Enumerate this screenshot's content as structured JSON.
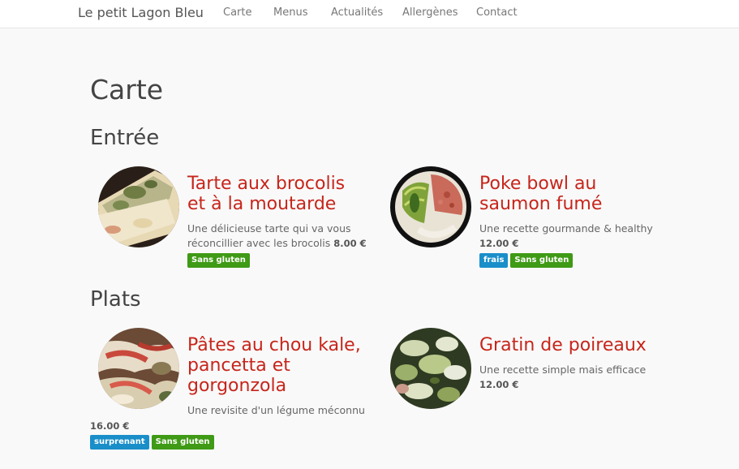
{
  "nav": {
    "brand": "Le petit Lagon Bleu",
    "links": [
      "Carte",
      "Menus",
      "Actualités",
      "Allergènes",
      "Contact"
    ]
  },
  "page_title": "Carte",
  "sections": [
    {
      "heading": "Entrée",
      "dishes": [
        {
          "title_lines": [
            "Tarte aux brocolis",
            "et à la moutarde"
          ],
          "description_lines": [
            "Une délicieuse tarte qui va vous",
            "réconcillier avec les brocolis"
          ],
          "price": "8.00 €",
          "tags": [
            "Sans gluten"
          ],
          "image_icon": "broccoli-tart-photo"
        },
        {
          "title_lines": [
            "Poke bowl au",
            "saumon fumé"
          ],
          "description_lines": [
            "Une recette gourmande & healthy"
          ],
          "price": "12.00 €",
          "tags": [
            "frais",
            "Sans gluten"
          ],
          "image_icon": "poke-bowl-photo"
        }
      ]
    },
    {
      "heading": "Plats",
      "dishes": [
        {
          "title_lines": [
            "Pâtes au chou kale,",
            "pancetta et",
            "gorgonzola"
          ],
          "description_lines": [
            "Une revisite d'un légume méconnu"
          ],
          "price": "16.00 €",
          "tags": [
            "surprenant",
            "Sans gluten"
          ],
          "image_icon": "pasta-kale-photo"
        },
        {
          "title_lines": [
            "Gratin de poireaux"
          ],
          "description_lines": [
            "Une recette simple mais efficace"
          ],
          "price": "12.00 €",
          "tags": [],
          "image_icon": "leek-gratin-photo"
        }
      ]
    }
  ],
  "colors": {
    "title_red": "#c7251b",
    "tag_green": "#3f9a16",
    "tag_blue": "#1a8ec9",
    "background": "#f9f9f9"
  }
}
